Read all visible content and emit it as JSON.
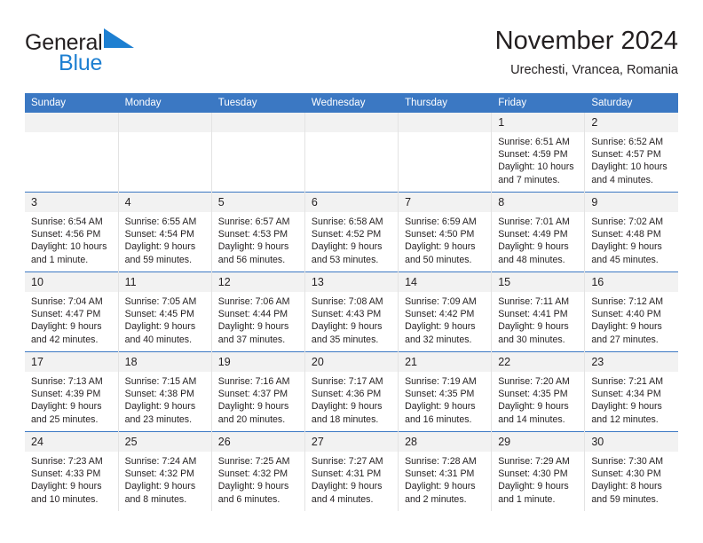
{
  "brand": {
    "name_top": "General",
    "name_bottom": "Blue",
    "logo_icon": "blue-triangle-icon",
    "color_primary": "#1d7fd1",
    "color_text": "#231f20"
  },
  "header": {
    "title": "November 2024",
    "subtitle": "Urechesti, Vrancea, Romania"
  },
  "calendar": {
    "header_bg": "#3b78c3",
    "header_text_color": "#ffffff",
    "daynum_bg": "#f2f2f2",
    "weekdays": [
      "Sunday",
      "Monday",
      "Tuesday",
      "Wednesday",
      "Thursday",
      "Friday",
      "Saturday"
    ],
    "labels": {
      "sunrise": "Sunrise:",
      "sunset": "Sunset:",
      "daylight": "Daylight:"
    },
    "weeks": [
      [
        {
          "day": ""
        },
        {
          "day": ""
        },
        {
          "day": ""
        },
        {
          "day": ""
        },
        {
          "day": ""
        },
        {
          "day": "1",
          "sunrise": "Sunrise: 6:51 AM",
          "sunset": "Sunset: 4:59 PM",
          "daylight_line1": "Daylight: 10 hours",
          "daylight_line2": "and 7 minutes."
        },
        {
          "day": "2",
          "sunrise": "Sunrise: 6:52 AM",
          "sunset": "Sunset: 4:57 PM",
          "daylight_line1": "Daylight: 10 hours",
          "daylight_line2": "and 4 minutes."
        }
      ],
      [
        {
          "day": "3",
          "sunrise": "Sunrise: 6:54 AM",
          "sunset": "Sunset: 4:56 PM",
          "daylight_line1": "Daylight: 10 hours",
          "daylight_line2": "and 1 minute."
        },
        {
          "day": "4",
          "sunrise": "Sunrise: 6:55 AM",
          "sunset": "Sunset: 4:54 PM",
          "daylight_line1": "Daylight: 9 hours",
          "daylight_line2": "and 59 minutes."
        },
        {
          "day": "5",
          "sunrise": "Sunrise: 6:57 AM",
          "sunset": "Sunset: 4:53 PM",
          "daylight_line1": "Daylight: 9 hours",
          "daylight_line2": "and 56 minutes."
        },
        {
          "day": "6",
          "sunrise": "Sunrise: 6:58 AM",
          "sunset": "Sunset: 4:52 PM",
          "daylight_line1": "Daylight: 9 hours",
          "daylight_line2": "and 53 minutes."
        },
        {
          "day": "7",
          "sunrise": "Sunrise: 6:59 AM",
          "sunset": "Sunset: 4:50 PM",
          "daylight_line1": "Daylight: 9 hours",
          "daylight_line2": "and 50 minutes."
        },
        {
          "day": "8",
          "sunrise": "Sunrise: 7:01 AM",
          "sunset": "Sunset: 4:49 PM",
          "daylight_line1": "Daylight: 9 hours",
          "daylight_line2": "and 48 minutes."
        },
        {
          "day": "9",
          "sunrise": "Sunrise: 7:02 AM",
          "sunset": "Sunset: 4:48 PM",
          "daylight_line1": "Daylight: 9 hours",
          "daylight_line2": "and 45 minutes."
        }
      ],
      [
        {
          "day": "10",
          "sunrise": "Sunrise: 7:04 AM",
          "sunset": "Sunset: 4:47 PM",
          "daylight_line1": "Daylight: 9 hours",
          "daylight_line2": "and 42 minutes."
        },
        {
          "day": "11",
          "sunrise": "Sunrise: 7:05 AM",
          "sunset": "Sunset: 4:45 PM",
          "daylight_line1": "Daylight: 9 hours",
          "daylight_line2": "and 40 minutes."
        },
        {
          "day": "12",
          "sunrise": "Sunrise: 7:06 AM",
          "sunset": "Sunset: 4:44 PM",
          "daylight_line1": "Daylight: 9 hours",
          "daylight_line2": "and 37 minutes."
        },
        {
          "day": "13",
          "sunrise": "Sunrise: 7:08 AM",
          "sunset": "Sunset: 4:43 PM",
          "daylight_line1": "Daylight: 9 hours",
          "daylight_line2": "and 35 minutes."
        },
        {
          "day": "14",
          "sunrise": "Sunrise: 7:09 AM",
          "sunset": "Sunset: 4:42 PM",
          "daylight_line1": "Daylight: 9 hours",
          "daylight_line2": "and 32 minutes."
        },
        {
          "day": "15",
          "sunrise": "Sunrise: 7:11 AM",
          "sunset": "Sunset: 4:41 PM",
          "daylight_line1": "Daylight: 9 hours",
          "daylight_line2": "and 30 minutes."
        },
        {
          "day": "16",
          "sunrise": "Sunrise: 7:12 AM",
          "sunset": "Sunset: 4:40 PM",
          "daylight_line1": "Daylight: 9 hours",
          "daylight_line2": "and 27 minutes."
        }
      ],
      [
        {
          "day": "17",
          "sunrise": "Sunrise: 7:13 AM",
          "sunset": "Sunset: 4:39 PM",
          "daylight_line1": "Daylight: 9 hours",
          "daylight_line2": "and 25 minutes."
        },
        {
          "day": "18",
          "sunrise": "Sunrise: 7:15 AM",
          "sunset": "Sunset: 4:38 PM",
          "daylight_line1": "Daylight: 9 hours",
          "daylight_line2": "and 23 minutes."
        },
        {
          "day": "19",
          "sunrise": "Sunrise: 7:16 AM",
          "sunset": "Sunset: 4:37 PM",
          "daylight_line1": "Daylight: 9 hours",
          "daylight_line2": "and 20 minutes."
        },
        {
          "day": "20",
          "sunrise": "Sunrise: 7:17 AM",
          "sunset": "Sunset: 4:36 PM",
          "daylight_line1": "Daylight: 9 hours",
          "daylight_line2": "and 18 minutes."
        },
        {
          "day": "21",
          "sunrise": "Sunrise: 7:19 AM",
          "sunset": "Sunset: 4:35 PM",
          "daylight_line1": "Daylight: 9 hours",
          "daylight_line2": "and 16 minutes."
        },
        {
          "day": "22",
          "sunrise": "Sunrise: 7:20 AM",
          "sunset": "Sunset: 4:35 PM",
          "daylight_line1": "Daylight: 9 hours",
          "daylight_line2": "and 14 minutes."
        },
        {
          "day": "23",
          "sunrise": "Sunrise: 7:21 AM",
          "sunset": "Sunset: 4:34 PM",
          "daylight_line1": "Daylight: 9 hours",
          "daylight_line2": "and 12 minutes."
        }
      ],
      [
        {
          "day": "24",
          "sunrise": "Sunrise: 7:23 AM",
          "sunset": "Sunset: 4:33 PM",
          "daylight_line1": "Daylight: 9 hours",
          "daylight_line2": "and 10 minutes."
        },
        {
          "day": "25",
          "sunrise": "Sunrise: 7:24 AM",
          "sunset": "Sunset: 4:32 PM",
          "daylight_line1": "Daylight: 9 hours",
          "daylight_line2": "and 8 minutes."
        },
        {
          "day": "26",
          "sunrise": "Sunrise: 7:25 AM",
          "sunset": "Sunset: 4:32 PM",
          "daylight_line1": "Daylight: 9 hours",
          "daylight_line2": "and 6 minutes."
        },
        {
          "day": "27",
          "sunrise": "Sunrise: 7:27 AM",
          "sunset": "Sunset: 4:31 PM",
          "daylight_line1": "Daylight: 9 hours",
          "daylight_line2": "and 4 minutes."
        },
        {
          "day": "28",
          "sunrise": "Sunrise: 7:28 AM",
          "sunset": "Sunset: 4:31 PM",
          "daylight_line1": "Daylight: 9 hours",
          "daylight_line2": "and 2 minutes."
        },
        {
          "day": "29",
          "sunrise": "Sunrise: 7:29 AM",
          "sunset": "Sunset: 4:30 PM",
          "daylight_line1": "Daylight: 9 hours",
          "daylight_line2": "and 1 minute."
        },
        {
          "day": "30",
          "sunrise": "Sunrise: 7:30 AM",
          "sunset": "Sunset: 4:30 PM",
          "daylight_line1": "Daylight: 8 hours",
          "daylight_line2": "and 59 minutes."
        }
      ]
    ]
  }
}
